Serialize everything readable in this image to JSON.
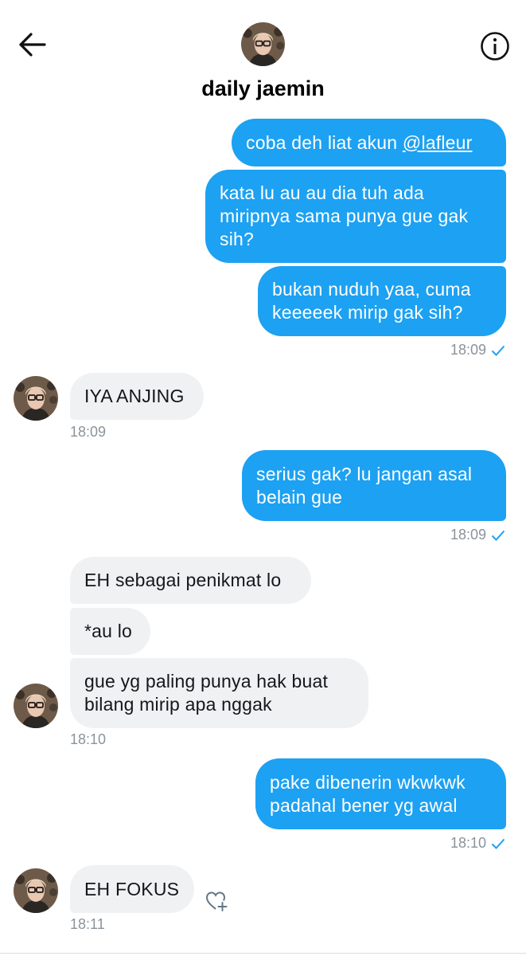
{
  "header": {
    "title": "daily jaemin",
    "back_icon": "arrow-left-icon",
    "info_icon": "info-icon"
  },
  "colors": {
    "outgoing_bubble": "#1da1f2",
    "incoming_bubble": "#f0f1f3",
    "timestamp": "#8a939b",
    "read_check": "#1da1f2"
  },
  "messages": {
    "m1": {
      "prefix": "coba deh liat akun ",
      "mention": "@lafleur"
    },
    "m2": "kata lu au au dia tuh ada miripnya sama punya gue gak sih?",
    "m3": "bukan nuduh yaa, cuma keeeeek mirip gak sih?",
    "t1": "18:09",
    "m4": "IYA ANJING",
    "t2": "18:09",
    "m5": "serius gak? lu jangan asal belain gue",
    "t3": "18:09",
    "m6": "EH sebagai penikmat lo",
    "m7": "*au lo",
    "m8": "gue yg paling punya hak buat bilang mirip apa nggak",
    "t4": "18:10",
    "m9": "pake dibenerin wkwkwk padahal bener yg awal",
    "t5": "18:10",
    "m10": "EH FOKUS",
    "t6": "18:11"
  }
}
